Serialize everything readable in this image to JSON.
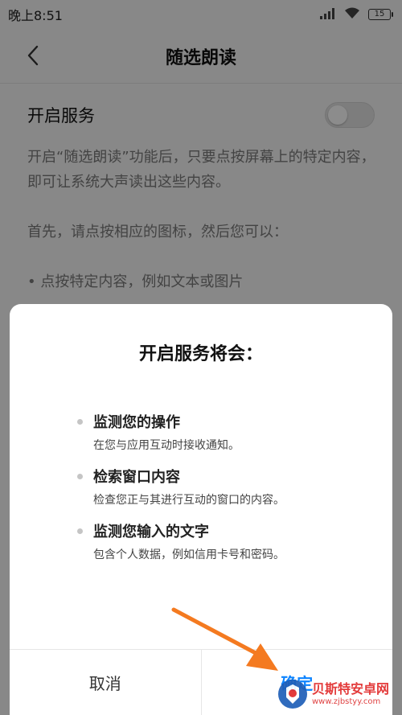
{
  "status_bar": {
    "time": "晚上8:51",
    "battery_level": "15",
    "icons": [
      "signal-icon",
      "wifi-icon",
      "battery-icon"
    ]
  },
  "header": {
    "back_icon": "chevron-left-icon",
    "title": "随选朗读"
  },
  "service_setting": {
    "label": "开启服务",
    "toggle_state": "off"
  },
  "description": {
    "paragraph_1": "开启“随选朗读”功能后，只要点按屏幕上的特定内容，即可让系统大声读出这些内容。",
    "paragraph_2": "首先，请点按相应的图标，然后您可以：",
    "bullet_1": "• 点按特定内容，例如文本或图片"
  },
  "dialog": {
    "title": "开启服务将会：",
    "permissions": [
      {
        "title": "监测您的操作",
        "desc": "在您与应用互动时接收通知。"
      },
      {
        "title": "检索窗口内容",
        "desc": "检查您正与其进行互动的窗口的内容。"
      },
      {
        "title": "监测您输入的文字",
        "desc": "包含个人数据，例如信用卡号和密码。"
      }
    ],
    "cancel_label": "取消",
    "confirm_label": "确定"
  },
  "annotation": {
    "arrow_color": "#f47a20",
    "arrow_target": "confirm-button"
  },
  "watermark": {
    "name": "贝斯特安卓网",
    "url": "www.zjbstyy.com",
    "colors": {
      "primary": "#e12b2b",
      "secondary": "#1f5fb8"
    }
  },
  "colors": {
    "accent_blue": "#0d84ff",
    "dim_overlay": "rgba(0,0,0,0.45)",
    "page_bg": "#f7f7f7"
  }
}
